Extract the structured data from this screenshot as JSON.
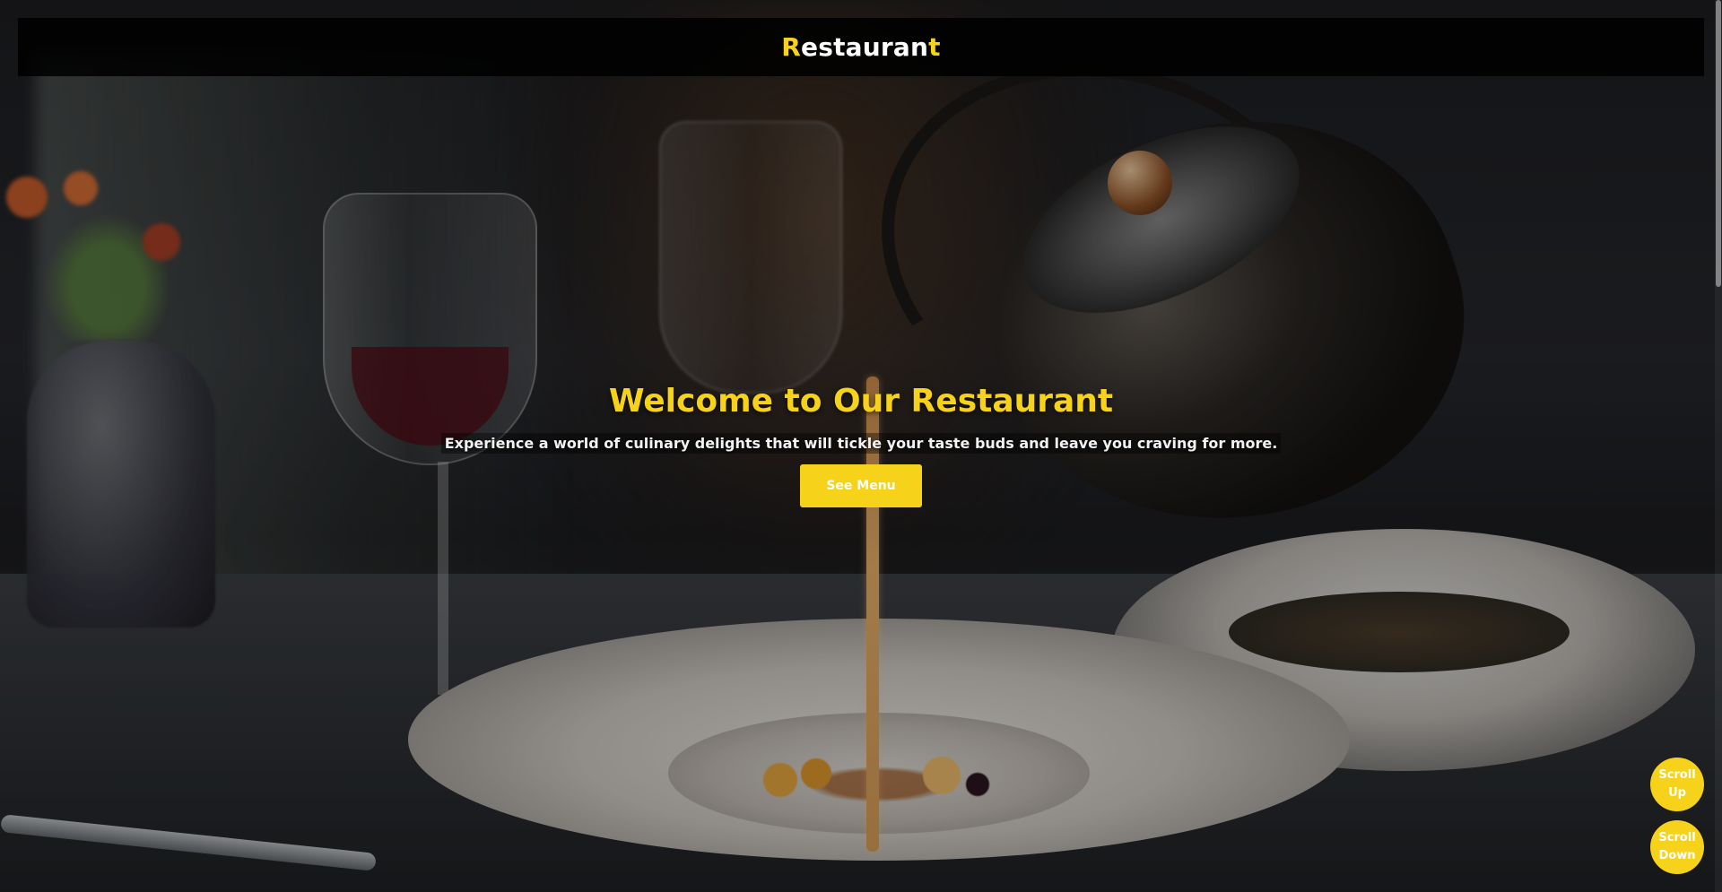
{
  "header": {
    "brand_first": "R",
    "brand_middle": "estauran",
    "brand_last": "t"
  },
  "hero": {
    "title": "Welcome to Our Restaurant",
    "subtitle": "Experience a world of culinary delights that will tickle your taste buds and leave you craving for more.",
    "cta_label": "See Menu"
  },
  "scroll": {
    "up_label": "Scroll Up",
    "down_label": "Scroll Down"
  },
  "colors": {
    "accent": "#f6d21b",
    "header_bg": "#000000",
    "text": "#ffffff"
  }
}
